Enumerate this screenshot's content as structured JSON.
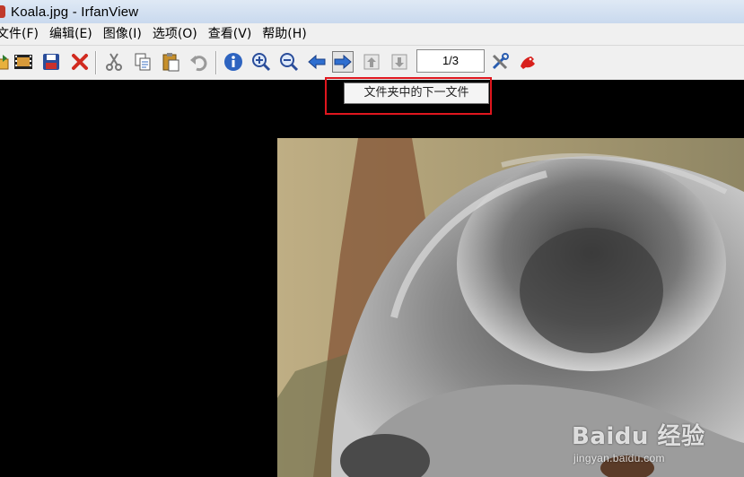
{
  "window": {
    "title": "Koala.jpg - IrfanView"
  },
  "menu": {
    "items": [
      "文件(F)",
      "编辑(E)",
      "图像(I)",
      "选项(O)",
      "查看(V)",
      "帮助(H)"
    ]
  },
  "toolbar": {
    "page_counter": "1/3",
    "icons": [
      "open-folder-icon",
      "slideshow-icon",
      "save-disk-icon",
      "delete-x-icon",
      "cut-scissors-icon",
      "copy-icon",
      "paste-icon",
      "undo-icon",
      "info-icon",
      "zoom-in-icon",
      "zoom-out-icon",
      "previous-arrow-icon",
      "next-arrow-icon",
      "first-page-icon",
      "last-page-icon",
      "settings-tools-icon",
      "irfanview-logo-icon"
    ]
  },
  "tooltip": {
    "text": "文件夹中的下一文件"
  },
  "watermark": {
    "brand": "Baidu 经验",
    "url": "jingyan.baidu.com"
  },
  "colors": {
    "highlight": "#e0161e",
    "titlebar": "#dfe9f5",
    "toolbar_bg": "#f0f0f0",
    "viewer_bg": "#000000"
  }
}
